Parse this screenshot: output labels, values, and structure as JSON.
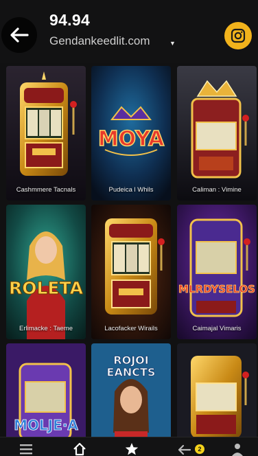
{
  "header": {
    "balance": "94.94",
    "site": "Gendankeedlit.com",
    "caret": "▼",
    "back_icon": "arrow-left-icon",
    "social_icon": "instagram-icon",
    "accent": "#f2b31c"
  },
  "games": [
    {
      "label": "Cashmmere Tacnals",
      "logo": "",
      "art": "slot-machine"
    },
    {
      "label": "Pudeica l Whils",
      "logo": "MOYA",
      "art": "logo"
    },
    {
      "label": "Caliman : Vimine",
      "logo": "",
      "art": "slot-machine-crown"
    },
    {
      "label": "Erlimacke : Taeme",
      "logo": "ROLETA",
      "art": "character"
    },
    {
      "label": "Lacofacker Wirails",
      "logo": "",
      "art": "slot-machine"
    },
    {
      "label": "Caimajal Vimaris",
      "logo": "MLRDYSELOS",
      "art": "slot-machine-purple"
    },
    {
      "label": "",
      "logo": "MOLJE·A",
      "art": "slot-machine-purple"
    },
    {
      "label": "",
      "logo": "ROJOI\nEANCTS",
      "art": "character"
    },
    {
      "label": "",
      "logo": "",
      "art": "slot-machine"
    }
  ],
  "bottom_nav": {
    "items": [
      "menu-icon",
      "home-icon",
      "star-icon",
      "wallet-icon",
      "profile-icon"
    ],
    "badge": "2"
  }
}
